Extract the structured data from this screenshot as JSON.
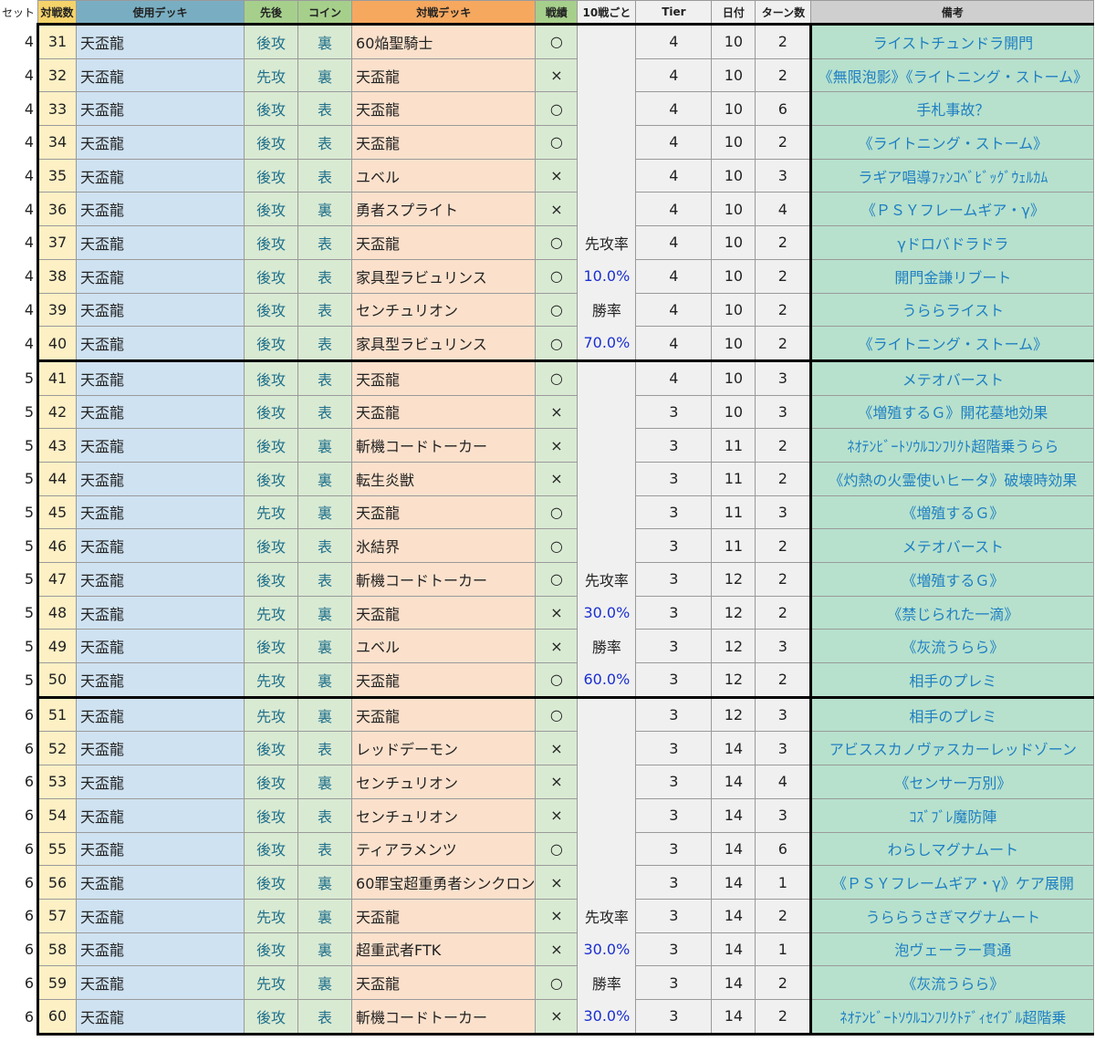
{
  "headers": {
    "set": "セット",
    "num": "対戦数",
    "deck": "使用デッキ",
    "order": "先後",
    "coin": "コイン",
    "opponent": "対戦デッキ",
    "result": "戦績",
    "ten": "10戦ごと",
    "tier": "Tier",
    "date": "日付",
    "turns": "ターン数",
    "notes": "備考"
  },
  "rows": [
    {
      "set": "4",
      "num": "31",
      "deck": "天盃龍",
      "order": "後攻",
      "coin": "裏",
      "opp": "60焔聖騎士",
      "result": "○",
      "ten": "",
      "tier": "4",
      "date": "10",
      "turns": "2",
      "notes": "ライストチュンドラ開門"
    },
    {
      "set": "4",
      "num": "32",
      "deck": "天盃龍",
      "order": "先攻",
      "coin": "裏",
      "opp": "天盃龍",
      "result": "×",
      "ten": "",
      "tier": "4",
      "date": "10",
      "turns": "2",
      "notes": "《無限泡影》《ライトニング・ストーム》"
    },
    {
      "set": "4",
      "num": "33",
      "deck": "天盃龍",
      "order": "後攻",
      "coin": "表",
      "opp": "天盃龍",
      "result": "○",
      "ten": "",
      "tier": "4",
      "date": "10",
      "turns": "6",
      "notes": "手札事故？"
    },
    {
      "set": "4",
      "num": "34",
      "deck": "天盃龍",
      "order": "後攻",
      "coin": "表",
      "opp": "天盃龍",
      "result": "○",
      "ten": "",
      "tier": "4",
      "date": "10",
      "turns": "2",
      "notes": "《ライトニング・ストーム》"
    },
    {
      "set": "4",
      "num": "35",
      "deck": "天盃龍",
      "order": "後攻",
      "coin": "表",
      "opp": "ユベル",
      "result": "×",
      "ten": "",
      "tier": "4",
      "date": "10",
      "turns": "3",
      "notes": "ラギア唱導ﾌｧﾝｺﾍﾞﾋﾞｯｸﾞｳｪﾙｶﾑ"
    },
    {
      "set": "4",
      "num": "36",
      "deck": "天盃龍",
      "order": "後攻",
      "coin": "裏",
      "opp": "勇者スプライト",
      "result": "×",
      "ten": "",
      "tier": "4",
      "date": "10",
      "turns": "4",
      "notes": "《ＰＳＹフレームギア・γ》"
    },
    {
      "set": "4",
      "num": "37",
      "deck": "天盃龍",
      "order": "後攻",
      "coin": "表",
      "opp": "天盃龍",
      "result": "○",
      "ten": "先攻率",
      "tier": "4",
      "date": "10",
      "turns": "2",
      "notes": "γドロバドラドラ"
    },
    {
      "set": "4",
      "num": "38",
      "deck": "天盃龍",
      "order": "後攻",
      "coin": "表",
      "opp": "家具型ラビュリンス",
      "result": "○",
      "ten": "10.0%",
      "tier": "4",
      "date": "10",
      "turns": "2",
      "notes": "開門金謙リブート"
    },
    {
      "set": "4",
      "num": "39",
      "deck": "天盃龍",
      "order": "後攻",
      "coin": "表",
      "opp": "センチュリオン",
      "result": "○",
      "ten": "勝率",
      "tier": "4",
      "date": "10",
      "turns": "2",
      "notes": "うららライスト"
    },
    {
      "set": "4",
      "num": "40",
      "deck": "天盃龍",
      "order": "後攻",
      "coin": "表",
      "opp": "家具型ラビュリンス",
      "result": "○",
      "ten": "70.0%",
      "tier": "4",
      "date": "10",
      "turns": "2",
      "notes": "《ライトニング・ストーム》"
    },
    {
      "set": "5",
      "num": "41",
      "deck": "天盃龍",
      "order": "後攻",
      "coin": "表",
      "opp": "天盃龍",
      "result": "○",
      "ten": "",
      "tier": "4",
      "date": "10",
      "turns": "3",
      "notes": "メテオバースト"
    },
    {
      "set": "5",
      "num": "42",
      "deck": "天盃龍",
      "order": "後攻",
      "coin": "表",
      "opp": "天盃龍",
      "result": "×",
      "ten": "",
      "tier": "3",
      "date": "10",
      "turns": "3",
      "notes": "《増殖するＧ》開花墓地効果"
    },
    {
      "set": "5",
      "num": "43",
      "deck": "天盃龍",
      "order": "後攻",
      "coin": "裏",
      "opp": "斬機コードトーカー",
      "result": "×",
      "ten": "",
      "tier": "3",
      "date": "11",
      "turns": "2",
      "notes": "ﾈｵﾃﾝﾋﾞｰﾄｿｳﾙｺﾝﾌﾘｸﾄ超階乗うらら"
    },
    {
      "set": "5",
      "num": "44",
      "deck": "天盃龍",
      "order": "後攻",
      "coin": "裏",
      "opp": "転生炎獣",
      "result": "×",
      "ten": "",
      "tier": "3",
      "date": "11",
      "turns": "2",
      "notes": "《灼熱の火霊使いヒータ》破壊時効果"
    },
    {
      "set": "5",
      "num": "45",
      "deck": "天盃龍",
      "order": "先攻",
      "coin": "裏",
      "opp": "天盃龍",
      "result": "○",
      "ten": "",
      "tier": "3",
      "date": "11",
      "turns": "3",
      "notes": "《増殖するＧ》"
    },
    {
      "set": "5",
      "num": "46",
      "deck": "天盃龍",
      "order": "後攻",
      "coin": "表",
      "opp": "氷結界",
      "result": "○",
      "ten": "",
      "tier": "3",
      "date": "11",
      "turns": "2",
      "notes": "メテオバースト"
    },
    {
      "set": "5",
      "num": "47",
      "deck": "天盃龍",
      "order": "後攻",
      "coin": "表",
      "opp": "斬機コードトーカー",
      "result": "○",
      "ten": "先攻率",
      "tier": "3",
      "date": "12",
      "turns": "2",
      "notes": "《増殖するＧ》"
    },
    {
      "set": "5",
      "num": "48",
      "deck": "天盃龍",
      "order": "先攻",
      "coin": "裏",
      "opp": "天盃龍",
      "result": "×",
      "ten": "30.0%",
      "tier": "3",
      "date": "12",
      "turns": "2",
      "notes": "《禁じられた一滴》"
    },
    {
      "set": "5",
      "num": "49",
      "deck": "天盃龍",
      "order": "後攻",
      "coin": "裏",
      "opp": "ユベル",
      "result": "×",
      "ten": "勝率",
      "tier": "3",
      "date": "12",
      "turns": "3",
      "notes": "《灰流うらら》"
    },
    {
      "set": "5",
      "num": "50",
      "deck": "天盃龍",
      "order": "先攻",
      "coin": "裏",
      "opp": "天盃龍",
      "result": "○",
      "ten": "60.0%",
      "tier": "3",
      "date": "12",
      "turns": "2",
      "notes": "相手のプレミ"
    },
    {
      "set": "6",
      "num": "51",
      "deck": "天盃龍",
      "order": "先攻",
      "coin": "裏",
      "opp": "天盃龍",
      "result": "○",
      "ten": "",
      "tier": "3",
      "date": "12",
      "turns": "3",
      "notes": "相手のプレミ"
    },
    {
      "set": "6",
      "num": "52",
      "deck": "天盃龍",
      "order": "後攻",
      "coin": "表",
      "opp": "レッドデーモン",
      "result": "×",
      "ten": "",
      "tier": "3",
      "date": "14",
      "turns": "3",
      "notes": "アビススカノヴァスカーレッドゾーン"
    },
    {
      "set": "6",
      "num": "53",
      "deck": "天盃龍",
      "order": "後攻",
      "coin": "裏",
      "opp": "センチュリオン",
      "result": "×",
      "ten": "",
      "tier": "3",
      "date": "14",
      "turns": "4",
      "notes": "《センサー万別》"
    },
    {
      "set": "6",
      "num": "54",
      "deck": "天盃龍",
      "order": "後攻",
      "coin": "表",
      "opp": "センチュリオン",
      "result": "×",
      "ten": "",
      "tier": "3",
      "date": "14",
      "turns": "3",
      "notes": "ｺｽﾞﾌﾞﾚ魔防陣"
    },
    {
      "set": "6",
      "num": "55",
      "deck": "天盃龍",
      "order": "後攻",
      "coin": "表",
      "opp": "ティアラメンツ",
      "result": "○",
      "ten": "",
      "tier": "3",
      "date": "14",
      "turns": "6",
      "notes": "わらしマグナムート"
    },
    {
      "set": "6",
      "num": "56",
      "deck": "天盃龍",
      "order": "後攻",
      "coin": "裏",
      "opp": "60罪宝超重勇者シンクロン",
      "result": "×",
      "ten": "",
      "tier": "3",
      "date": "14",
      "turns": "1",
      "notes": "《ＰＳＹフレームギア・γ》ケア展開"
    },
    {
      "set": "6",
      "num": "57",
      "deck": "天盃龍",
      "order": "先攻",
      "coin": "裏",
      "opp": "天盃龍",
      "result": "×",
      "ten": "先攻率",
      "tier": "3",
      "date": "14",
      "turns": "2",
      "notes": "うららうさぎマグナムート"
    },
    {
      "set": "6",
      "num": "58",
      "deck": "天盃龍",
      "order": "後攻",
      "coin": "裏",
      "opp": "超重武者FTK",
      "result": "×",
      "ten": "30.0%",
      "tier": "3",
      "date": "14",
      "turns": "1",
      "notes": "泡ヴェーラー貫通"
    },
    {
      "set": "6",
      "num": "59",
      "deck": "天盃龍",
      "order": "先攻",
      "coin": "裏",
      "opp": "天盃龍",
      "result": "○",
      "ten": "勝率",
      "tier": "3",
      "date": "14",
      "turns": "2",
      "notes": "《灰流うらら》"
    },
    {
      "set": "6",
      "num": "60",
      "deck": "天盃龍",
      "order": "後攻",
      "coin": "表",
      "opp": "斬機コードトーカー",
      "result": "×",
      "ten": "30.0%",
      "tier": "3",
      "date": "14",
      "turns": "2",
      "notes": "ﾈｵﾃﾝﾋﾞｰﾄｿｳﾙｺﾝﾌﾘｸﾄﾃﾞｨｾｲﾌﾞﾙ超階乗"
    }
  ]
}
